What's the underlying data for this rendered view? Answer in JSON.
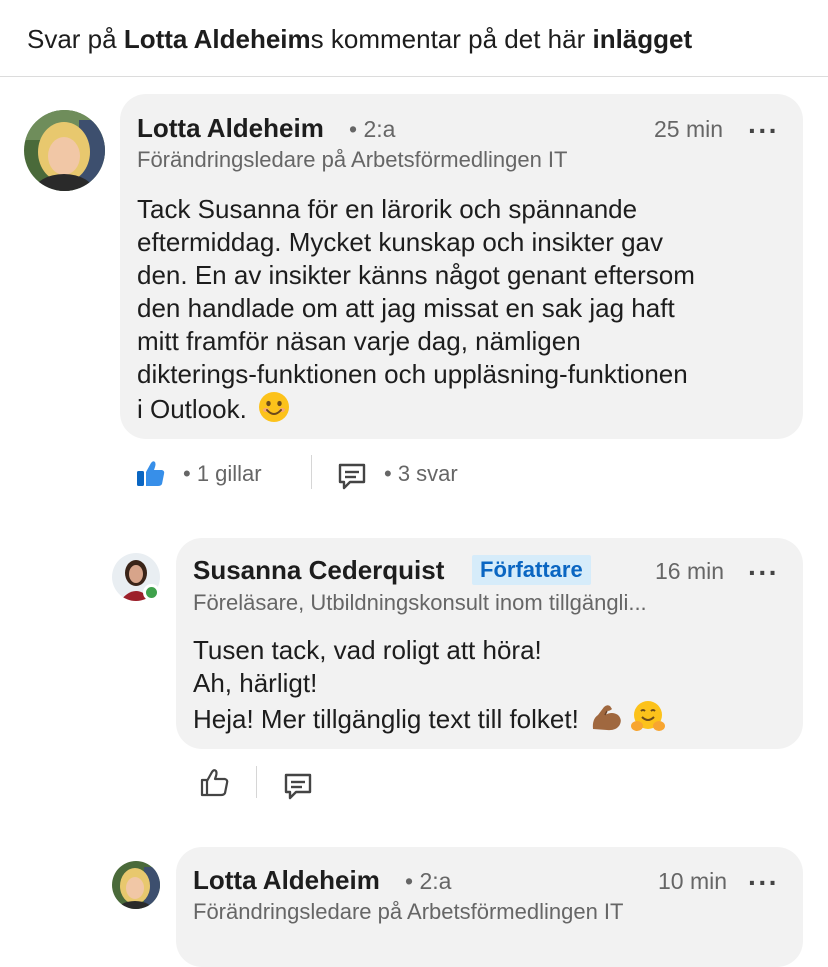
{
  "header": {
    "prefix": "Svar på ",
    "commenter": "Lotta Aldeheim",
    "suffix": "s kommentar på det här ",
    "post": "inlägget"
  },
  "comments": [
    {
      "name": "Lotta Aldeheim",
      "degree": "• 2:a",
      "time": "25 min",
      "headline": "Förändringsledare på Arbetsförmedlingen IT",
      "lines": [
        "Tack Susanna för en lärorik och spännande",
        "eftermiddag. Mycket kunskap och insikter gav",
        "den. En av insikter känns något genant eftersom",
        "den handlade om att jag missat en sak jag haft",
        "mitt framför näsan varje dag, nämligen",
        "dikterings-funktionen och uppläsning-funktionen",
        "i Outlook."
      ],
      "likes": "• 1 gillar",
      "replies": "• 3 svar",
      "more": "···"
    },
    {
      "name": "Susanna Cederquist",
      "badge": "Författare",
      "time": "16 min",
      "headline": "Föreläsare, Utbildningskonsult inom tillgängli...",
      "lines": [
        "Tusen tack, vad roligt att höra!",
        "Ah, härligt!",
        "Heja! Mer tillgänglig text till folket!"
      ],
      "more": "···"
    },
    {
      "name": "Lotta Aldeheim",
      "degree": "• 2:a",
      "time": "10 min",
      "headline": "Förändringsledare på Arbetsförmedlingen IT",
      "more": "···"
    }
  ],
  "colors": {
    "like_blue": "#0a66c2",
    "badge_bg": "#d6ecfa",
    "bubble_bg": "#f2f2f2",
    "online_green": "#3fa14b"
  },
  "icons": [
    "smile-emoji-icon",
    "like-reaction-icon",
    "comment-icon",
    "flexed-biceps-emoji-icon",
    "hugging-face-emoji-icon",
    "thumbs-up-outline-icon"
  ]
}
